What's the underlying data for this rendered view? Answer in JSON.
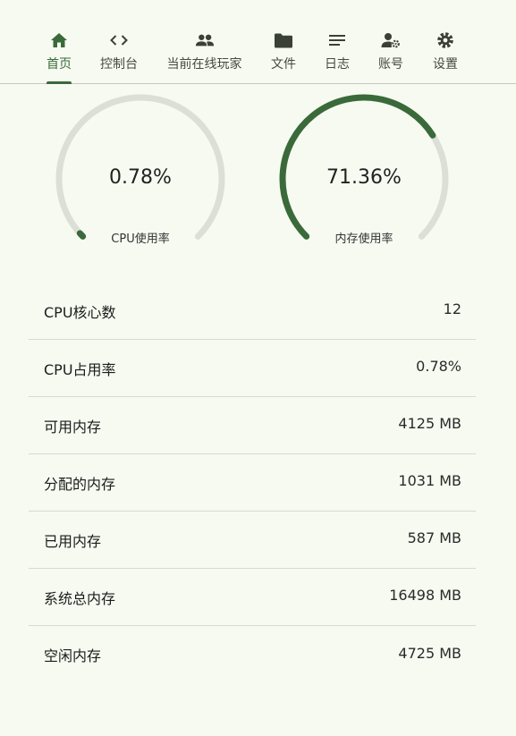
{
  "nav": {
    "items": [
      {
        "label": "首页",
        "icon": "home-icon",
        "active": true
      },
      {
        "label": "控制台",
        "icon": "code-icon"
      },
      {
        "label": "当前在线玩家",
        "icon": "group-icon"
      },
      {
        "label": "文件",
        "icon": "folder-icon"
      },
      {
        "label": "日志",
        "icon": "notes-icon"
      },
      {
        "label": "账号",
        "icon": "manage-account-icon"
      },
      {
        "label": "设置",
        "icon": "gear-icon"
      }
    ]
  },
  "gauges": [
    {
      "value_text": "0.78%",
      "percent": 0.78,
      "caption": "CPU使用率"
    },
    {
      "value_text": "71.36%",
      "percent": 71.36,
      "caption": "内存使用率"
    }
  ],
  "stats": [
    {
      "label": "CPU核心数",
      "value": "12"
    },
    {
      "label": "CPU占用率",
      "value": "0.78%"
    },
    {
      "label": "可用内存",
      "value": "4125 MB"
    },
    {
      "label": "分配的内存",
      "value": "1031 MB"
    },
    {
      "label": "已用内存",
      "value": "587 MB"
    },
    {
      "label": "系统总内存",
      "value": "16498 MB"
    },
    {
      "label": "空闲内存",
      "value": "4725 MB"
    }
  ],
  "colors": {
    "accent": "#3a6a3a",
    "track": "#dcdfd6",
    "background": "#f7faf1",
    "icon": "#3b4037"
  }
}
